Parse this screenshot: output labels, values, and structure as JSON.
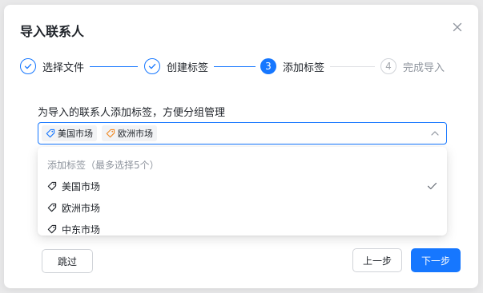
{
  "dialog": {
    "title": "导入联系人",
    "close_icon": "close-icon"
  },
  "steps": [
    {
      "label": "选择文件",
      "status": "done",
      "icon": "check-icon"
    },
    {
      "label": "创建标签",
      "status": "done",
      "icon": "check-icon"
    },
    {
      "label": "添加标签",
      "status": "active",
      "number": "3"
    },
    {
      "label": "完成导入",
      "status": "todo",
      "number": "4"
    }
  ],
  "form": {
    "label": "为导入的联系人添加标签，方便分组管理",
    "selected_tags": [
      {
        "label": "美国市场",
        "color": "#1677ff"
      },
      {
        "label": "欧洲市场",
        "color": "#f08a24"
      }
    ]
  },
  "dropdown": {
    "header": "添加标签（最多选择5个）",
    "items": [
      {
        "label": "美国市场",
        "selected": true
      },
      {
        "label": "欧洲市场",
        "selected": false
      },
      {
        "label": "中东市场",
        "selected": false
      }
    ]
  },
  "footer": {
    "skip_label": "跳过",
    "prev_label": "上一步",
    "next_label": "下一步"
  },
  "colors": {
    "accent": "#1677ff",
    "tag_blue": "#1677ff",
    "tag_orange": "#f08a24"
  }
}
